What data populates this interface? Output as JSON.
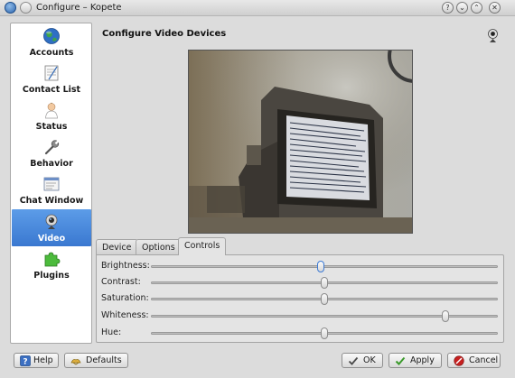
{
  "window": {
    "title": "Configure – Kopete",
    "help_glyph": "?",
    "minimize_glyph": "⌄",
    "maximize_glyph": "⌃",
    "close_glyph": "✕"
  },
  "sidebar": {
    "items": [
      {
        "label": "Accounts",
        "icon": "globe-icon"
      },
      {
        "label": "Contact List",
        "icon": "contact-list-icon"
      },
      {
        "label": "Status",
        "icon": "person-icon"
      },
      {
        "label": "Behavior",
        "icon": "wrench-icon"
      },
      {
        "label": "Chat Window",
        "icon": "chat-window-icon"
      },
      {
        "label": "Video",
        "icon": "webcam-icon",
        "active": true
      },
      {
        "label": "Plugins",
        "icon": "puzzle-icon"
      }
    ]
  },
  "page": {
    "title": "Configure Video Devices"
  },
  "tabs": [
    {
      "label": "Device",
      "active": false
    },
    {
      "label": "Options",
      "active": false
    },
    {
      "label": "Controls",
      "active": true
    }
  ],
  "controls": [
    {
      "label": "Brightness:",
      "value": 0.49,
      "focused": true
    },
    {
      "label": "Contrast:",
      "value": 0.5
    },
    {
      "label": "Saturation:",
      "value": 0.5
    },
    {
      "label": "Whiteness:",
      "value": 0.85
    },
    {
      "label": "Hue:",
      "value": 0.5
    }
  ],
  "buttons": {
    "help": "Help",
    "defaults": "Defaults",
    "ok": "OK",
    "apply": "Apply",
    "cancel": "Cancel"
  },
  "colors": {
    "accent": "#4a8ae0",
    "ok_check": "#3a9a2a",
    "cancel_red": "#c62020"
  }
}
